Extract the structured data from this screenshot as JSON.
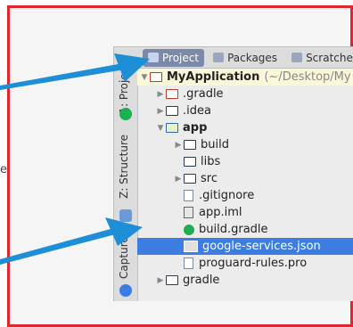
{
  "side_text": "e",
  "vertical_tabs": {
    "tab1": "1: Project",
    "structure": "Z: Structure",
    "captures": "Captures"
  },
  "tool_tabs": [
    {
      "label": "Project",
      "active": true
    },
    {
      "label": "Packages",
      "active": false
    },
    {
      "label": "Scratches",
      "active": false
    }
  ],
  "tree": {
    "root": {
      "label": "MyApplication",
      "path": "(~/Desktop/My"
    },
    "items": [
      {
        "label": ".gradle"
      },
      {
        "label": ".idea"
      },
      {
        "label": "app"
      },
      {
        "label": "build"
      },
      {
        "label": "libs"
      },
      {
        "label": "src"
      },
      {
        "label": ".gitignore"
      },
      {
        "label": "app.iml"
      },
      {
        "label": "build.gradle"
      },
      {
        "label": "google-services.json",
        "selected": true
      },
      {
        "label": "proguard-rules.pro"
      },
      {
        "label": "gradle"
      }
    ]
  },
  "colors": {
    "frame_border": "#e3262c",
    "arrow": "#1e8fd6",
    "selection": "#3d7de2"
  }
}
